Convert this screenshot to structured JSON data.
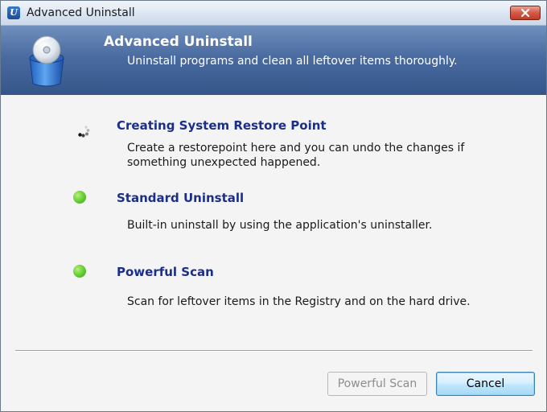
{
  "window": {
    "title": "Advanced Uninstall"
  },
  "banner": {
    "title": "Advanced Uninstall",
    "subtitle": "Uninstall programs and clean all leftover items thoroughly."
  },
  "steps": [
    {
      "title": "Creating System Restore Point",
      "description": "Create a restorepoint here and you can undo the changes if something unexpected happened.",
      "status_icon": "spinner-icon"
    },
    {
      "title": "Standard Uninstall",
      "description": "Built-in uninstall by using the application's uninstaller.",
      "status_icon": "green-dot-icon"
    },
    {
      "title": "Powerful Scan",
      "description": "Scan for leftover items in the Registry and on the hard drive.",
      "status_icon": "green-dot-icon"
    }
  ],
  "buttons": {
    "scan_label": "Powerful Scan",
    "cancel_label": "Cancel"
  },
  "colors": {
    "banner": "#4a6ba0",
    "step_title": "#1a2e8a",
    "status_dot": "#6cd23a"
  }
}
